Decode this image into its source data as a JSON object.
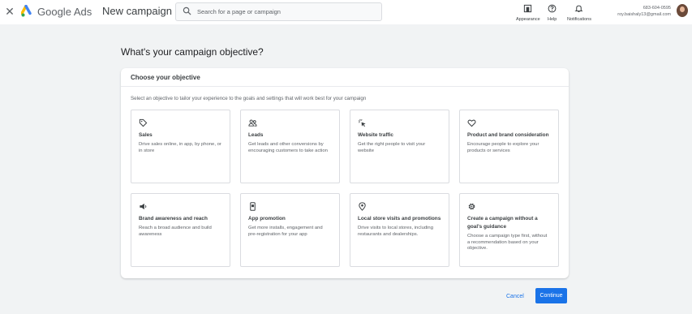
{
  "header": {
    "brand": "Google Ads",
    "page_name": "New campaign",
    "search_placeholder": "Search for a page or campaign",
    "tools": [
      {
        "label": "Appearance",
        "icon": "appearance-icon"
      },
      {
        "label": "Help",
        "icon": "help-icon"
      },
      {
        "label": "Notifications",
        "icon": "bell-icon"
      }
    ],
    "account_id": "683-604-0595",
    "account_email": "roy.baishaly13@gmail.com"
  },
  "main": {
    "heading": "What's your campaign objective?",
    "panel_title": "Choose your objective",
    "panel_description": "Select an objective to tailor your experience to the goals and settings that will work best for your campaign",
    "objectives": [
      {
        "title": "Sales",
        "description": "Drive sales online, in app, by phone, or in store",
        "icon": "tag-icon"
      },
      {
        "title": "Leads",
        "description": "Get leads and other conversions by encouraging customers to take action",
        "icon": "people-icon"
      },
      {
        "title": "Website traffic",
        "description": "Get the right people to visit your website",
        "icon": "cursor-click-icon"
      },
      {
        "title": "Product and brand consideration",
        "description": "Encourage people to explore your products or services",
        "icon": "heart-icon"
      },
      {
        "title": "Brand awareness and reach",
        "description": "Reach a broad audience and build awareness",
        "icon": "megaphone-icon"
      },
      {
        "title": "App promotion",
        "description": "Get more installs, engagement and pre-registration for your app",
        "icon": "phone-icon"
      },
      {
        "title": "Local store visits and promotions",
        "description": "Drive visits to local stores, including restaurants and dealerships.",
        "icon": "location-pin-icon"
      },
      {
        "title": "Create a campaign without a goal's guidance",
        "description": "Choose a campaign type first, without a recommendation based on your objective.",
        "icon": "gear-icon"
      }
    ]
  },
  "footer": {
    "cancel_label": "Cancel",
    "continue_label": "Continue"
  },
  "colors": {
    "accent": "#1a73e8",
    "background": "#f1f3f4"
  }
}
